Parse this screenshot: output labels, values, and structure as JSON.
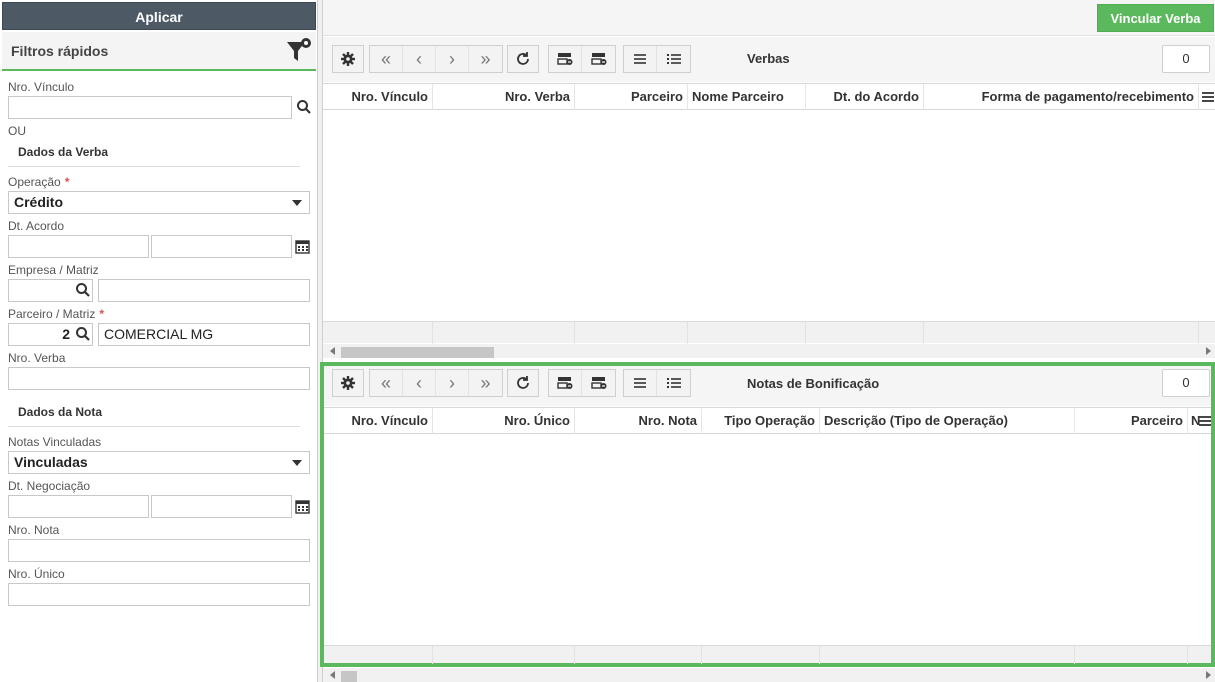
{
  "filter_panel": {
    "apply_label": "Aplicar",
    "title": "Filtros rápidos",
    "nro_vinculo_label": "Nro. Vínculo",
    "or_label": "OU",
    "section_verba": "Dados da Verba",
    "operacao_label": "Operação",
    "operacao_value": "Crédito",
    "dt_acordo_label": "Dt. Acordo",
    "empresa_label": "Empresa / Matriz",
    "parceiro_label": "Parceiro / Matriz",
    "parceiro_code": "2",
    "parceiro_name": "COMERCIAL MG",
    "nro_verba_label": "Nro. Verba",
    "section_nota": "Dados da Nota",
    "notas_vinculadas_label": "Notas Vinculadas",
    "notas_vinculadas_value": "Vinculadas",
    "dt_negociacao_label": "Dt. Negociação",
    "nro_nota_label": "Nro. Nota",
    "nro_unico_label": "Nro. Único",
    "required_mark": "*"
  },
  "top_actions": {
    "link_label": "Vincular Verba"
  },
  "grid_verbas": {
    "title": "Verbas",
    "count": "0",
    "columns": [
      "Nro. Vínculo",
      "Nro. Verba",
      "Parceiro",
      "Nome Parceiro",
      "Dt. do Acordo",
      "Forma de pagamento/recebimento"
    ]
  },
  "grid_notas": {
    "title": "Notas de Bonificação",
    "count": "0",
    "columns": [
      "Nro. Vínculo",
      "Nro. Único",
      "Nro. Nota",
      "Tipo Operação",
      "Descrição (Tipo de Operação)",
      "Parceiro",
      "N"
    ]
  },
  "icons": {
    "settings": "gear-icon",
    "first": "double-chevron-left-icon",
    "prev": "chevron-left-icon",
    "next": "chevron-right-icon",
    "last": "double-chevron-right-icon",
    "refresh": "refresh-icon",
    "filter": "filter-settings-icon",
    "search": "search-icon",
    "calendar": "calendar-icon"
  },
  "colors": {
    "accent_green": "#5cb85c",
    "apply_bg": "#4d5a66",
    "required": "#d9534f"
  }
}
